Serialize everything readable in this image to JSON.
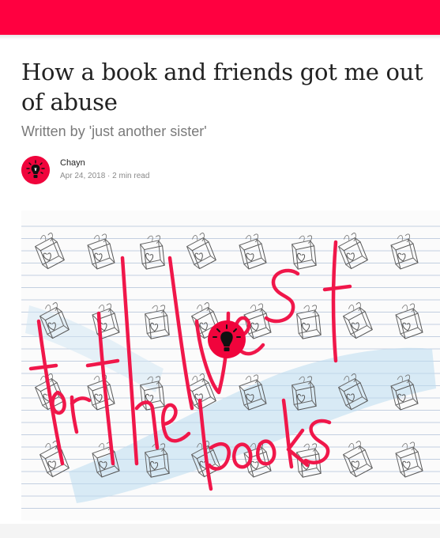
{
  "header": {
    "brand_color": "#ff0040"
  },
  "article": {
    "title": "How a book and friends got me out of abuse",
    "subtitle": "Written by 'just another sister'",
    "author": {
      "name": "Chayn",
      "avatar_icon": "lightbulb-icon",
      "avatar_color": "#f0043c"
    },
    "date": "Apr 24, 2018",
    "separator": "·",
    "read_time": "2 min read",
    "meta_line": "Apr 24, 2018 · 2 min read"
  },
  "hero": {
    "description_icon": "book-doodle-icon",
    "handwriting_color": "#f0174a",
    "line_color": "#c3cfe0"
  }
}
